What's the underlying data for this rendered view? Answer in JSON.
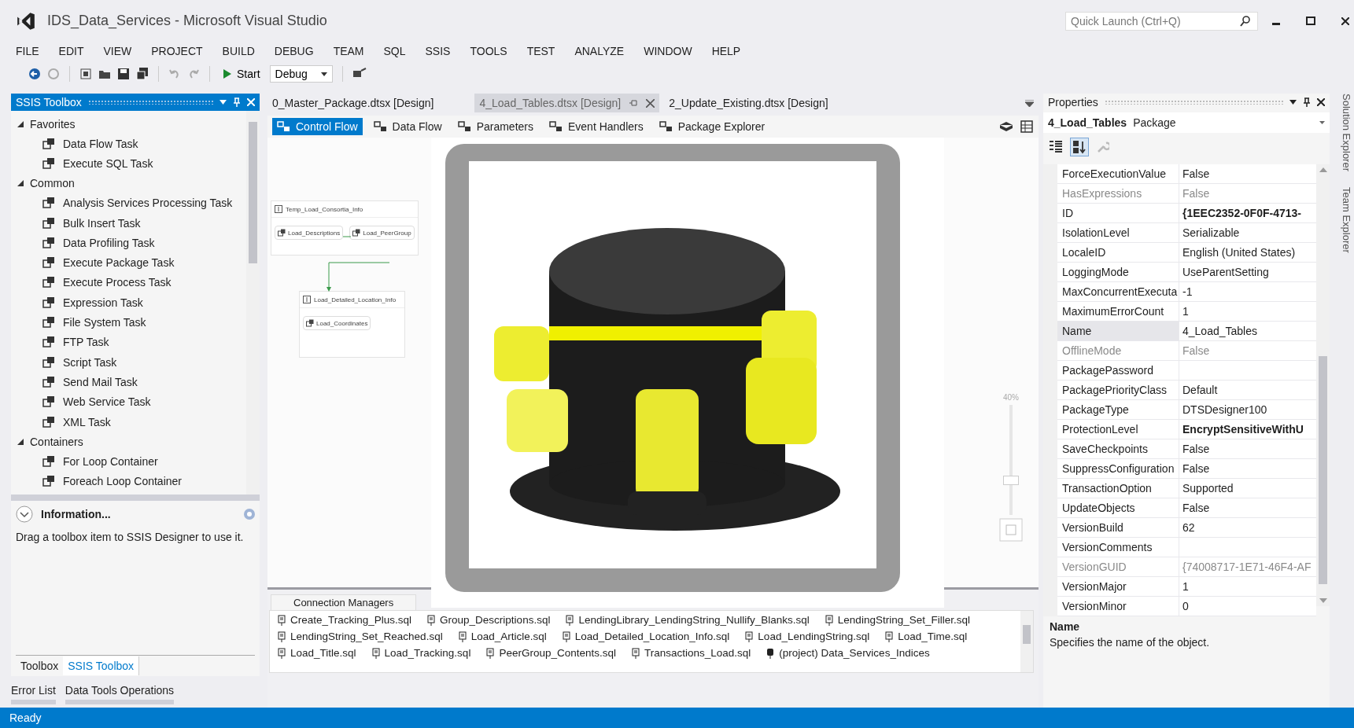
{
  "window": {
    "title": "IDS_Data_Services - Microsoft Visual Studio",
    "quick_launch_placeholder": "Quick Launch (Ctrl+Q)"
  },
  "menu": [
    "FILE",
    "EDIT",
    "VIEW",
    "PROJECT",
    "BUILD",
    "DEBUG",
    "TEAM",
    "SQL",
    "SSIS",
    "TOOLS",
    "TEST",
    "ANALYZE",
    "WINDOW",
    "HELP"
  ],
  "toolbar": {
    "start_label": "Start",
    "configuration": "Debug"
  },
  "toolbox": {
    "title": "SSIS Toolbox",
    "groups": [
      {
        "label": "Favorites",
        "expanded": true,
        "items": [
          "Data Flow Task",
          "Execute SQL Task"
        ]
      },
      {
        "label": "Common",
        "expanded": true,
        "items": [
          "Analysis Services Processing Task",
          "Bulk Insert Task",
          "Data Profiling Task",
          "Execute Package Task",
          "Execute Process Task",
          "Expression Task",
          "File System Task",
          "FTP Task",
          "Script Task",
          "Send Mail Task",
          "Web Service Task",
          "XML Task"
        ]
      },
      {
        "label": "Containers",
        "expanded": true,
        "items": [
          "For Loop Container",
          "Foreach Loop Container"
        ]
      }
    ],
    "info": {
      "title": "Information...",
      "text": "Drag a toolbox item to SSIS Designer to use it."
    },
    "tabs": [
      {
        "label": "Toolbox",
        "selected": false
      },
      {
        "label": "SSIS Toolbox",
        "selected": true
      }
    ]
  },
  "bottom_tabs": [
    "Error List",
    "Data Tools Operations"
  ],
  "documents": {
    "tabs": [
      {
        "label": "0_Master_Package.dtsx [Design]",
        "selected": false
      },
      {
        "label": "4_Load_Tables.dtsx [Design]",
        "selected": true
      },
      {
        "label": "2_Update_Existing.dtsx [Design]",
        "selected": false
      }
    ],
    "designer_tabs": [
      {
        "label": "Control Flow",
        "selected": true
      },
      {
        "label": "Data Flow",
        "selected": false
      },
      {
        "label": "Parameters",
        "selected": false
      },
      {
        "label": "Event Handlers",
        "selected": false
      },
      {
        "label": "Package Explorer",
        "selected": false
      }
    ],
    "canvas": {
      "containers": [
        {
          "title": "Temp_Load_Consortia_Info",
          "tasks": [
            "Load_Descriptions",
            "Load_PeerGroup"
          ]
        },
        {
          "title": "Load_Detailed_Location_Info",
          "tasks": [
            "Load_Coordinates"
          ]
        }
      ],
      "zoom": {
        "label": "40%",
        "level": 0.3
      }
    },
    "connection_managers": {
      "title": "Connection Managers",
      "items": [
        {
          "label": "Create_Tracking_Plus.sql",
          "kind": "file"
        },
        {
          "label": "Group_Descriptions.sql",
          "kind": "file"
        },
        {
          "label": "LendingLibrary_LendingString_Nullify_Blanks.sql",
          "kind": "file"
        },
        {
          "label": "LendingString_Set_Filler.sql",
          "kind": "file"
        },
        {
          "label": "LendingString_Set_Reached.sql",
          "kind": "file"
        },
        {
          "label": "Load_Article.sql",
          "kind": "file"
        },
        {
          "label": "Load_Detailed_Location_Info.sql",
          "kind": "file"
        },
        {
          "label": "Load_LendingString.sql",
          "kind": "file"
        },
        {
          "label": "Load_Time.sql",
          "kind": "file"
        },
        {
          "label": "Load_Title.sql",
          "kind": "file"
        },
        {
          "label": "Load_Tracking.sql",
          "kind": "file"
        },
        {
          "label": "PeerGroup_Contents.sql",
          "kind": "file"
        },
        {
          "label": "Transactions_Load.sql",
          "kind": "file"
        },
        {
          "label": "(project) Data_Services_Indices",
          "kind": "project"
        }
      ]
    }
  },
  "properties": {
    "title": "Properties",
    "object_name": "4_Load_Tables",
    "object_type": "Package",
    "rows": [
      {
        "name": "ForceExecutionValue",
        "value": "False",
        "bold": false,
        "disabled": false,
        "selected": false
      },
      {
        "name": "HasExpressions",
        "value": "False",
        "bold": false,
        "disabled": true,
        "selected": false
      },
      {
        "name": "ID",
        "value": "{1EEC2352-0F0F-4713-",
        "bold": true,
        "disabled": false,
        "selected": false
      },
      {
        "name": "IsolationLevel",
        "value": "Serializable",
        "bold": false,
        "disabled": false,
        "selected": false
      },
      {
        "name": "LocaleID",
        "value": "English (United States)",
        "bold": false,
        "disabled": false,
        "selected": false
      },
      {
        "name": "LoggingMode",
        "value": "UseParentSetting",
        "bold": false,
        "disabled": false,
        "selected": false
      },
      {
        "name": "MaxConcurrentExecuta",
        "value": "-1",
        "bold": false,
        "disabled": false,
        "selected": false
      },
      {
        "name": "MaximumErrorCount",
        "value": "1",
        "bold": false,
        "disabled": false,
        "selected": false
      },
      {
        "name": "Name",
        "value": "4_Load_Tables",
        "bold": false,
        "disabled": false,
        "selected": true
      },
      {
        "name": "OfflineMode",
        "value": "False",
        "bold": false,
        "disabled": true,
        "selected": false
      },
      {
        "name": "PackagePassword",
        "disabled": false,
        "selected": false
      },
      {
        "name": "PackagePriorityClass",
        "value": "Default",
        "bold": false,
        "disabled": false,
        "selected": false
      },
      {
        "name": "PackageType",
        "value": "DTSDesigner100",
        "bold": false,
        "disabled": false,
        "selected": false
      },
      {
        "name": "ProtectionLevel",
        "value": "EncryptSensitiveWithU",
        "bold": true,
        "disabled": false,
        "selected": false
      },
      {
        "name": "SaveCheckpoints",
        "value": "False",
        "bold": false,
        "disabled": false,
        "selected": false
      },
      {
        "name": "SuppressConfiguration",
        "value": "False",
        "bold": false,
        "disabled": false,
        "selected": false
      },
      {
        "name": "TransactionOption",
        "value": "Supported",
        "bold": false,
        "disabled": false,
        "selected": false
      },
      {
        "name": "UpdateObjects",
        "value": "False",
        "bold": false,
        "disabled": false,
        "selected": false
      },
      {
        "name": "VersionBuild",
        "value": "62",
        "bold": false,
        "disabled": false,
        "selected": false
      },
      {
        "name": "VersionComments",
        "disabled": false,
        "selected": false
      },
      {
        "name": "VersionGUID",
        "value": "{74008717-1E71-46F4-AF",
        "bold": false,
        "disabled": true,
        "selected": false
      },
      {
        "name": "VersionMajor",
        "value": "1",
        "bold": false,
        "disabled": false,
        "selected": false
      },
      {
        "name": "VersionMinor",
        "value": "0",
        "bold": false,
        "disabled": false,
        "selected": false
      }
    ],
    "description": {
      "title": "Name",
      "text": "Specifies the name of the object."
    }
  },
  "side_tabs": [
    "Solution Explorer",
    "Team Explorer"
  ],
  "status": "Ready"
}
